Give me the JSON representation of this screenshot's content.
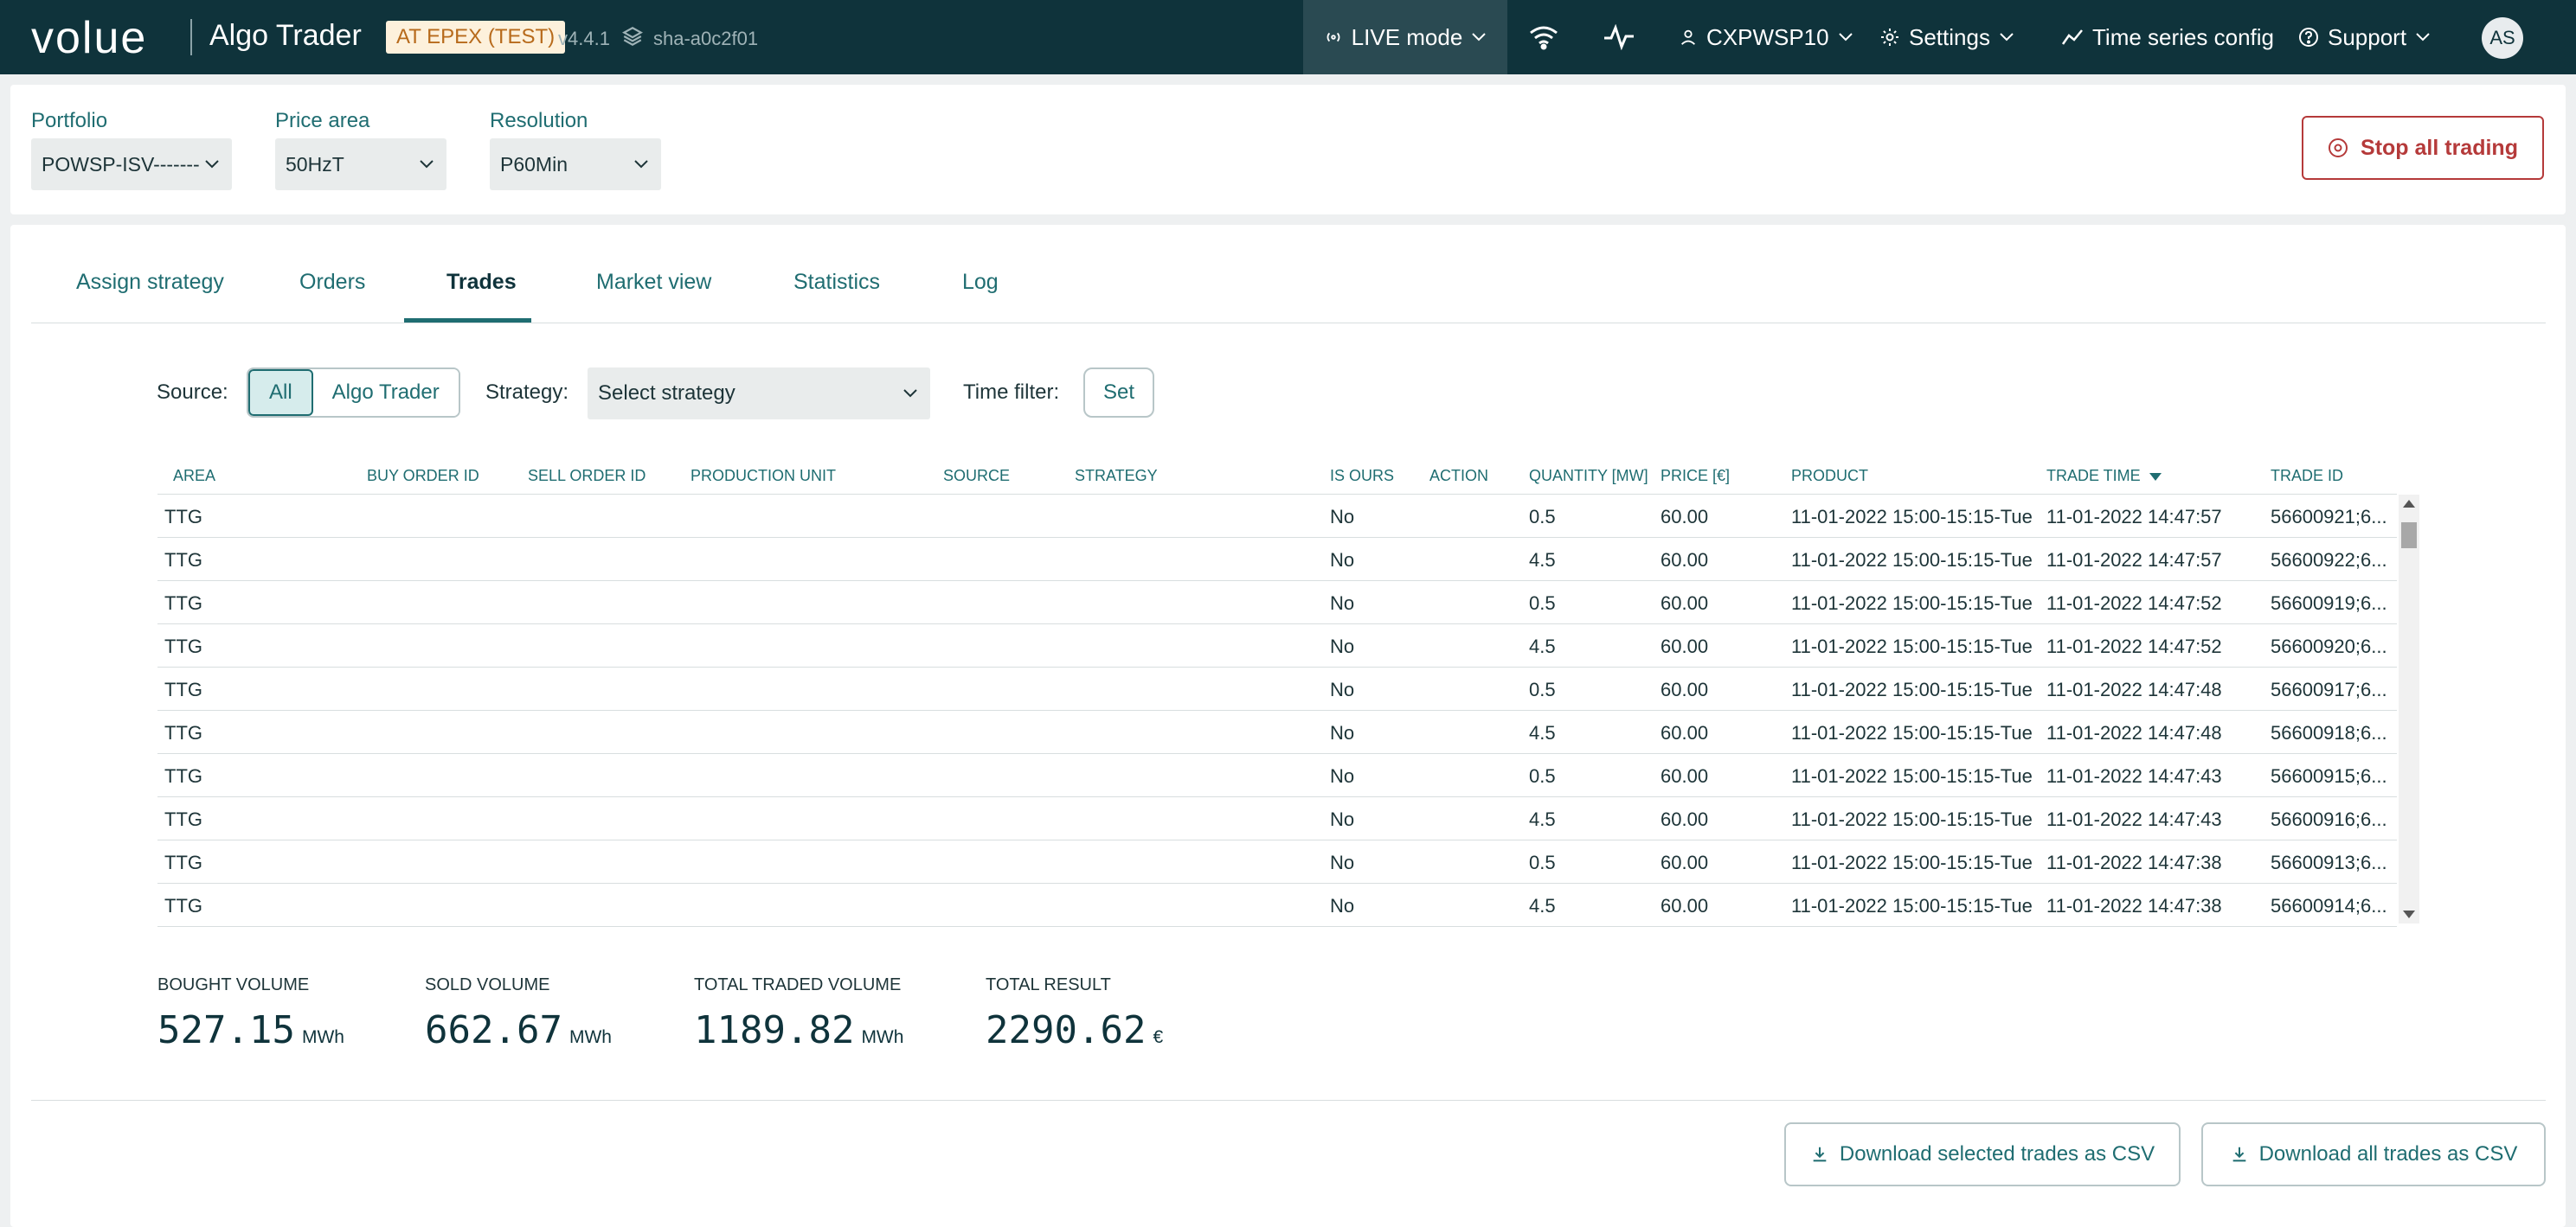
{
  "header": {
    "brand": "volue",
    "app_title": "Algo Trader",
    "env_badge": "AT EPEX (TEST)",
    "version": "v4.4.1",
    "sha": "sha-a0c2f01",
    "live_mode": "LIVE mode",
    "user": "CXPWSP10",
    "settings": "Settings",
    "time_series": "Time series config",
    "support": "Support",
    "avatar": "AS"
  },
  "filters": {
    "portfolio_label": "Portfolio",
    "portfolio_value": "POWSP-ISV-------",
    "price_area_label": "Price area",
    "price_area_value": "50HzT",
    "resolution_label": "Resolution",
    "resolution_value": "P60Min",
    "stop_button": "Stop all trading"
  },
  "tabs": [
    "Assign strategy",
    "Orders",
    "Trades",
    "Market view",
    "Statistics",
    "Log"
  ],
  "toolbar": {
    "source_label": "Source:",
    "source_all": "All",
    "source_algo": "Algo Trader",
    "strategy_label": "Strategy:",
    "strategy_placeholder": "Select strategy",
    "time_filter_label": "Time filter:",
    "set_button": "Set"
  },
  "table": {
    "columns": [
      "Area",
      "Buy order ID",
      "Sell order ID",
      "Production unit",
      "Source",
      "Strategy",
      "Is ours",
      "Action",
      "Quantity [MW]",
      "Price [€]",
      "Product",
      "Trade time",
      "Trade ID"
    ],
    "rows": [
      [
        "TTG",
        "",
        "",
        "",
        "",
        "",
        "No",
        "",
        "0.5",
        "60.00",
        "11-01-2022 15:00-15:15-Tue",
        "11-01-2022 14:47:57",
        "56600921;6..."
      ],
      [
        "TTG",
        "",
        "",
        "",
        "",
        "",
        "No",
        "",
        "4.5",
        "60.00",
        "11-01-2022 15:00-15:15-Tue",
        "11-01-2022 14:47:57",
        "56600922;6..."
      ],
      [
        "TTG",
        "",
        "",
        "",
        "",
        "",
        "No",
        "",
        "0.5",
        "60.00",
        "11-01-2022 15:00-15:15-Tue",
        "11-01-2022 14:47:52",
        "56600919;6..."
      ],
      [
        "TTG",
        "",
        "",
        "",
        "",
        "",
        "No",
        "",
        "4.5",
        "60.00",
        "11-01-2022 15:00-15:15-Tue",
        "11-01-2022 14:47:52",
        "56600920;6..."
      ],
      [
        "TTG",
        "",
        "",
        "",
        "",
        "",
        "No",
        "",
        "0.5",
        "60.00",
        "11-01-2022 15:00-15:15-Tue",
        "11-01-2022 14:47:48",
        "56600917;6..."
      ],
      [
        "TTG",
        "",
        "",
        "",
        "",
        "",
        "No",
        "",
        "4.5",
        "60.00",
        "11-01-2022 15:00-15:15-Tue",
        "11-01-2022 14:47:48",
        "56600918;6..."
      ],
      [
        "TTG",
        "",
        "",
        "",
        "",
        "",
        "No",
        "",
        "0.5",
        "60.00",
        "11-01-2022 15:00-15:15-Tue",
        "11-01-2022 14:47:43",
        "56600915;6..."
      ],
      [
        "TTG",
        "",
        "",
        "",
        "",
        "",
        "No",
        "",
        "4.5",
        "60.00",
        "11-01-2022 15:00-15:15-Tue",
        "11-01-2022 14:47:43",
        "56600916;6..."
      ],
      [
        "TTG",
        "",
        "",
        "",
        "",
        "",
        "No",
        "",
        "0.5",
        "60.00",
        "11-01-2022 15:00-15:15-Tue",
        "11-01-2022 14:47:38",
        "56600913;6..."
      ],
      [
        "TTG",
        "",
        "",
        "",
        "",
        "",
        "No",
        "",
        "4.5",
        "60.00",
        "11-01-2022 15:00-15:15-Tue",
        "11-01-2022 14:47:38",
        "56600914;6..."
      ]
    ]
  },
  "summary": {
    "bought_label": "Bought volume",
    "bought_value": "527.15",
    "bought_unit": "MWh",
    "sold_label": "Sold volume",
    "sold_value": "662.67",
    "sold_unit": "MWh",
    "total_traded_label": "Total traded volume",
    "total_traded_value": "1189.82",
    "total_traded_unit": "MWh",
    "total_result_label": "Total result",
    "total_result_value": "2290.62",
    "total_result_unit": "€"
  },
  "actions": {
    "download_selected": "Download selected trades as CSV",
    "download_all": "Download all trades as CSV"
  },
  "colors": {
    "topbar": "#0f333b",
    "accent": "#1f6d71",
    "danger": "#b53a3a",
    "badge_bg": "#fdf1dc",
    "badge_text": "#b76a1b"
  }
}
